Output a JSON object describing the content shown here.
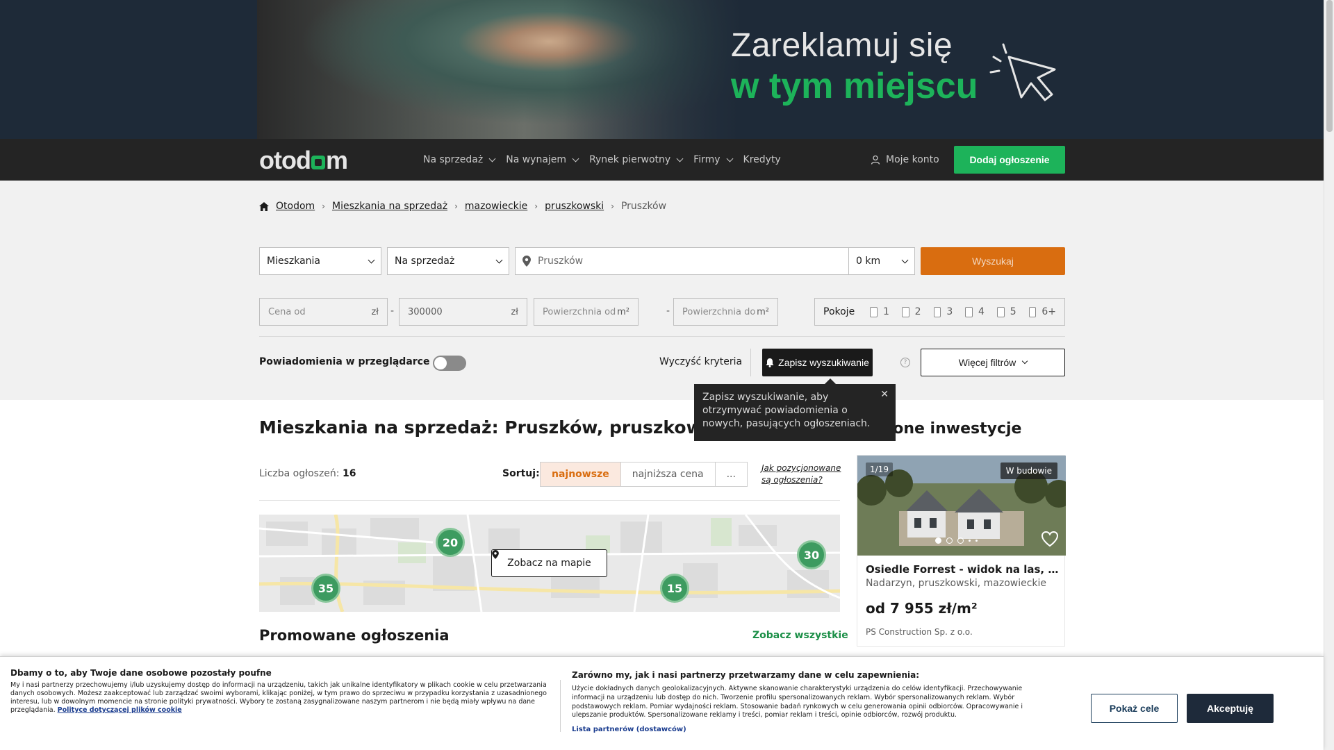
{
  "banner": {
    "line1": "Zareklamuj się",
    "line2": "w tym miejscu"
  },
  "nav": {
    "logo": "otodom",
    "links": [
      "Na sprzedaż",
      "Na wynajem",
      "Rynek pierwotny",
      "Firmy",
      "Kredyty"
    ],
    "account": "Moje konto",
    "add_button": "Dodaj ogłoszenie"
  },
  "breadcrumb": [
    "Otodom",
    "Mieszkania na sprzedaż",
    "mazowieckie",
    "pruszkowski",
    "Pruszków"
  ],
  "search": {
    "property_type": "Mieszkania",
    "transaction": "Na sprzedaż",
    "location": "Pruszków",
    "distance": "0 km",
    "search_button": "Wyszukaj",
    "price_from_placeholder": "Cena od",
    "price_to_value": "300000",
    "currency": "zł",
    "area_from_placeholder": "Powierzchnia od",
    "area_to_placeholder": "Powierzchnia do",
    "area_unit": "m²",
    "rooms_label": "Pokoje",
    "rooms": [
      "1",
      "2",
      "3",
      "4",
      "5",
      "6+"
    ],
    "notifications_label": "Powiadomienia w przeglądarce",
    "clear_label": "Wyczyść kryteria",
    "save_label": "Zapisz wyszukiwanie",
    "more_filters_label": "Więcej filtrów"
  },
  "tooltip": {
    "text": "Zapisz wyszukiwanie, aby otrzymywać powiadomienia o nowych, pasujących ogłoszeniach."
  },
  "results": {
    "title": "Mieszkania na sprzedaż: Pruszków, pruszkowski",
    "count_label": "Liczba ogłoszeń:",
    "count_value": "16",
    "sort_label": "Sortuj:",
    "sort_options": [
      "najnowsze",
      "najniższa cena",
      "..."
    ],
    "how_link": "Jak pozycjonowane są ogłoszenia?",
    "map_button": "Zobacz na mapie",
    "map_clusters": [
      "20",
      "30",
      "35",
      "15"
    ],
    "promo_title": "Promowane ogłoszenia",
    "promo_link": "Zobacz wszystkie"
  },
  "invest": {
    "section_title": "nione inwestycje",
    "photo_counter": "1/19",
    "status": "W budowie",
    "name": "Osiedle Forrest - widok na las, design,...",
    "location": "Nadarzyn, pruszkowski, mazowieckie",
    "price": "od 7 955 zł/m²",
    "developer": "PS Construction Sp. z o.o."
  },
  "cookie": {
    "title": "Dbamy o to, aby Twoje dane osobowe pozostały poufne",
    "body": "My i nasi partnerzy przechowujemy i/lub uzyskujemy dostęp do informacji na urządzeniu, takich jak unikalne identyfikatory w plikach cookie w celu przetwarzania danych osobowych. Możesz zaakceptować lub zarządzać swoimi wyborami, klikając poniżej, w tym prawo do sprzeciwu w przypadku korzystania z uzasadnionego interesu, lub w dowolnym momencie na stronie polityki prywatności. Wybory te zostaną zasygnalizowane naszym partnerom i nie będą miały wpływu na dane przeglądania.",
    "policy_link": "Polityce dotyczącej plików cookie",
    "title2": "Zarówno my, jak i nasi partnerzy przetwarzamy dane w celu zapewnienia:",
    "body2": "Użycie dokładnych danych geolokalizacyjnych. Aktywne skanowanie charakterystyki urządzenia do celów identyfikacji. Przechowywanie informacji na urządzeniu lub dostęp do nich. Tworzenie profilu spersonalizowanych reklam. Wybór spersonalizowanych reklam. Wybór podstawowych reklam. Pomiar wydajności reklam. Stosowanie badań rynkowych w celu generowania opinii odbiorców. Opracowywanie i ulepszanie produktów. Spersonalizowane reklamy i treści, pomiar reklam i treści, opinie odbiorców, rozwój produktu.",
    "partners_link": "Lista partnerów (dostawców)",
    "purposes_button": "Pokaż cele",
    "accept_button": "Akceptuję"
  }
}
